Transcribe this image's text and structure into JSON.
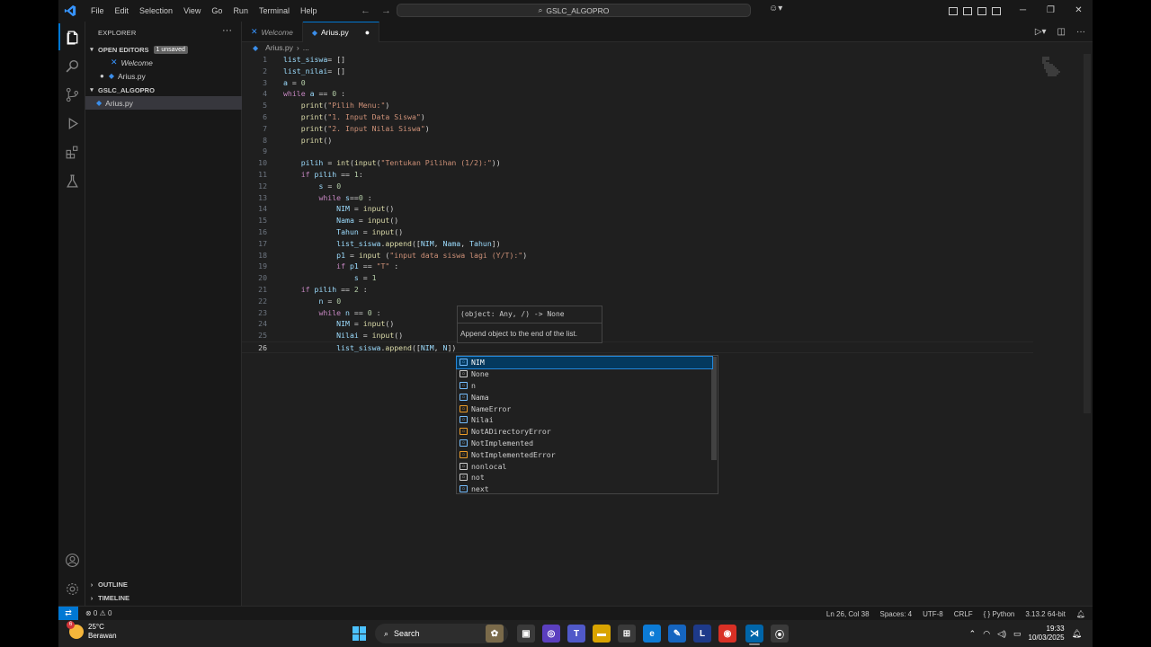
{
  "titlebar": {
    "menu": [
      "File",
      "Edit",
      "Selection",
      "View",
      "Go",
      "Run",
      "Terminal",
      "Help"
    ],
    "command_center": "GSLC_ALGOPRO"
  },
  "sidebar": {
    "title": "EXPLORER",
    "open_editors": {
      "label": "OPEN EDITORS",
      "badge": "1 unsaved"
    },
    "open_items": [
      {
        "label": "Welcome"
      },
      {
        "label": "Arius.py"
      }
    ],
    "folder": {
      "label": "GSLC_ALGOPRO"
    },
    "files": [
      {
        "label": "Arius.py"
      }
    ],
    "outline": "OUTLINE",
    "timeline": "TIMELINE"
  },
  "tabs": [
    {
      "label": "Welcome"
    },
    {
      "label": "Arius.py"
    }
  ],
  "breadcrumb": [
    "Arius.py",
    "..."
  ],
  "editor": {
    "lines": [
      "list_siswa= []",
      "list_nilai= []",
      "a = 0",
      "while a == 0 :",
      "    print(\"Pilih Menu:\")",
      "    print(\"1. Input Data Siswa\")",
      "    print(\"2. Input Nilai Siswa\")",
      "    print()",
      "",
      "    pilih = int(input(\"Tentukan Pilihan (1/2):\"))",
      "    if pilih == 1:",
      "        s = 0",
      "        while s==0 :",
      "            NIM = input()",
      "            Nama = input()",
      "            Tahun = input()",
      "            list_siswa.append([NIM, Nama, Tahun])",
      "            p1 = input (\"input data siswa lagi (Y/T):\")",
      "            if p1 == \"T\" :",
      "                s = 1",
      "    if pilih == 2 :",
      "        n = 0",
      "        while n == 0 :",
      "            NIM = input()",
      "            Nilai = input()",
      "            list_siswa.append([NIM, N])"
    ],
    "current_line": 26
  },
  "signature_help": {
    "signature": "(object: Any, /) -> None",
    "doc": "Append object to the end of the list."
  },
  "suggestions": [
    {
      "label": "NIM",
      "kind": "var"
    },
    {
      "label": "None",
      "kind": "kw"
    },
    {
      "label": "n",
      "kind": "var"
    },
    {
      "label": "Nama",
      "kind": "var"
    },
    {
      "label": "NameError",
      "kind": "cls"
    },
    {
      "label": "Nilai",
      "kind": "var"
    },
    {
      "label": "NotADirectoryError",
      "kind": "cls"
    },
    {
      "label": "NotImplemented",
      "kind": "var"
    },
    {
      "label": "NotImplementedError",
      "kind": "cls"
    },
    {
      "label": "nonlocal",
      "kind": "kw"
    },
    {
      "label": "not",
      "kind": "kw"
    },
    {
      "label": "next",
      "kind": "fn"
    }
  ],
  "statusbar": {
    "problems": "⊗ 0 ⚠ 0",
    "position": "Ln 26, Col 38",
    "spaces": "Spaces: 4",
    "encoding": "UTF-8",
    "eol": "CRLF",
    "language": "{ } Python",
    "interpreter": "3.13.2 64-bit"
  },
  "taskbar": {
    "temp": "25°C",
    "weather": "Berawan",
    "weather_badge": "6",
    "search": "Search",
    "time": "19:33",
    "date": "10/03/2025"
  },
  "colors": {
    "accent": "#0078d4",
    "editor_bg": "#1f1f1f",
    "sidebar_bg": "#181818"
  }
}
